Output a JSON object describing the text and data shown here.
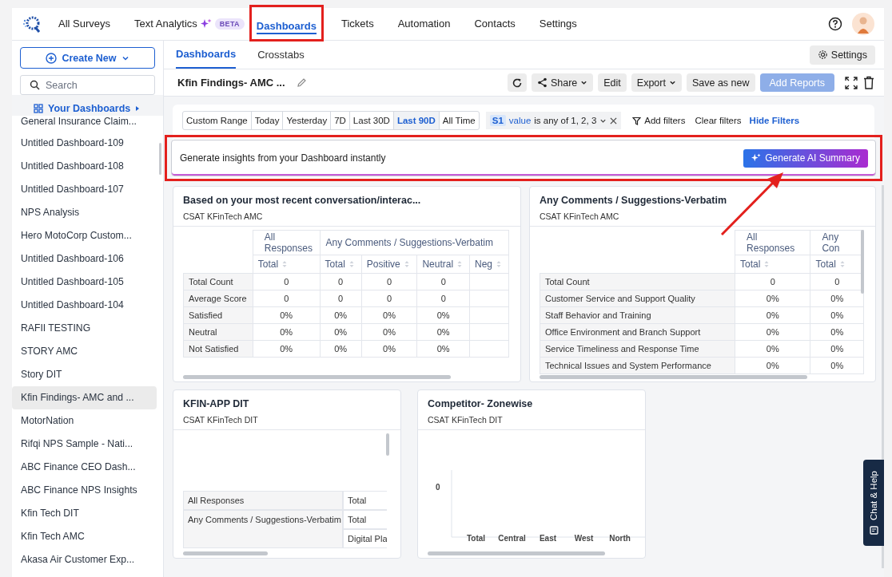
{
  "nav": {
    "items": [
      {
        "label": "All Surveys",
        "selected": false,
        "highlighted": false
      },
      {
        "label": "Text Analytics",
        "selected": false,
        "highlighted": false,
        "badge": "BETA",
        "sparkle": true
      },
      {
        "label": "Dashboards",
        "selected": true,
        "highlighted": true
      },
      {
        "label": "Tickets",
        "selected": false,
        "highlighted": false
      },
      {
        "label": "Automation",
        "selected": false,
        "highlighted": false
      },
      {
        "label": "Contacts",
        "selected": false,
        "highlighted": false
      },
      {
        "label": "Settings",
        "selected": false,
        "highlighted": false
      }
    ]
  },
  "sidebar": {
    "create_button": "Create New",
    "search": {
      "placeholder": "Search"
    },
    "section": "Your Dashboards",
    "items": [
      {
        "label": "General Insurance Claim...",
        "selected": false
      },
      {
        "label": "Untitled Dashboard-109",
        "selected": false
      },
      {
        "label": "Untitled Dashboard-108",
        "selected": false
      },
      {
        "label": "Untitled Dashboard-107",
        "selected": false
      },
      {
        "label": "NPS Analysis",
        "selected": false
      },
      {
        "label": "Hero MotoCorp Custom...",
        "selected": false
      },
      {
        "label": "Untitled Dashboard-106",
        "selected": false
      },
      {
        "label": "Untitled Dashboard-105",
        "selected": false
      },
      {
        "label": "Untitled Dashboard-104",
        "selected": false
      },
      {
        "label": "RAFII TESTING",
        "selected": false
      },
      {
        "label": "STORY AMC",
        "selected": false
      },
      {
        "label": "Story DIT",
        "selected": false
      },
      {
        "label": "Kfin Findings- AMC and ...",
        "selected": true
      },
      {
        "label": "MotorNation",
        "selected": false
      },
      {
        "label": "Rifqi NPS Sample - Nati...",
        "selected": false
      },
      {
        "label": "ABC Finance CEO Dash...",
        "selected": false
      },
      {
        "label": "ABC Finance NPS Insights",
        "selected": false
      },
      {
        "label": "Kfin Tech DIT",
        "selected": false
      },
      {
        "label": "Kfin Tech AMC",
        "selected": false
      },
      {
        "label": "Akasa Air Customer Exp...",
        "selected": false
      }
    ]
  },
  "subtabs": [
    {
      "label": "Dashboards",
      "selected": true
    },
    {
      "label": "Crosstabs",
      "selected": false
    }
  ],
  "settings_button": "Settings",
  "dashboard_title": "Kfin Findings- AMC ...",
  "toolbar": {
    "share": "Share",
    "edit": "Edit",
    "export": "Export",
    "save_as_new": "Save as new",
    "add_reports": {
      "label": "Add Reports",
      "disabled": true
    }
  },
  "date_ranges": [
    {
      "label": "Custom Range",
      "selected": false
    },
    {
      "label": "Today",
      "selected": false
    },
    {
      "label": "Yesterday",
      "selected": false
    },
    {
      "label": "7D",
      "selected": false
    },
    {
      "label": "Last 30D",
      "selected": false
    },
    {
      "label": "Last 90D",
      "selected": true
    },
    {
      "label": "All Time",
      "selected": false
    }
  ],
  "filter_chip": {
    "tag": "S1",
    "field": "value",
    "condition": "is any of 1, 2, 3"
  },
  "filter_actions": {
    "add": "Add filters",
    "clear": "Clear filters",
    "hide": "Hide Filters"
  },
  "banner": {
    "text": "Generate insights from your Dashboard instantly",
    "button": "Generate AI Summary",
    "highlighted": true
  },
  "panels": [
    {
      "kind": "table",
      "title": "Based on your most recent conversation/interac...",
      "subtitle": "CSAT KFinTech AMC",
      "groups": [
        {
          "label": "All Responses"
        },
        {
          "label": "Any Comments / Suggestions-Verbatim"
        }
      ],
      "columns": [
        "Total",
        "Total",
        "Positive",
        "Neutral",
        "Neg"
      ],
      "rows": [
        {
          "label": "Total Count",
          "cells": [
            "0",
            "0",
            "0",
            "0"
          ]
        },
        {
          "label": "Average Score",
          "cells": [
            "0",
            "0",
            "0",
            "0"
          ]
        },
        {
          "label": "Satisfied",
          "cells": [
            "0%",
            "0%",
            "0%",
            "0%"
          ]
        },
        {
          "label": "Neutral",
          "cells": [
            "0%",
            "0%",
            "0%",
            "0%"
          ]
        },
        {
          "label": "Not Satisfied",
          "cells": [
            "0%",
            "0%",
            "0%",
            "0%"
          ]
        }
      ]
    },
    {
      "kind": "table",
      "title": "Any Comments / Suggestions-Verbatim",
      "subtitle": "CSAT KFinTech AMC",
      "groups": [
        {
          "label": "All Responses"
        },
        {
          "label": "Any Con"
        }
      ],
      "columns": [
        "Total",
        "Total"
      ],
      "rows": [
        {
          "label": "Total Count",
          "cells": [
            "0",
            "0"
          ]
        },
        {
          "label": "Customer Service and Support Quality",
          "cells": [
            "0%",
            "0%"
          ]
        },
        {
          "label": "Staff Behavior and Training",
          "cells": [
            "0%",
            "0%"
          ]
        },
        {
          "label": "Office Environment and Branch Support",
          "cells": [
            "0%",
            "0%"
          ]
        },
        {
          "label": "Service Timeliness and Response Time",
          "cells": [
            "0%",
            "0%"
          ]
        },
        {
          "label": "Technical Issues and System Performance",
          "cells": [
            "0%",
            "0%"
          ]
        }
      ]
    },
    {
      "kind": "tree",
      "title": "KFIN-APP DIT",
      "subtitle": "CSAT KFinTech DIT",
      "rows": [
        {
          "label": "All Responses",
          "values": [
            "Total"
          ]
        },
        {
          "label": "Any Comments / Suggestions-Verbatim",
          "values": [
            "Total",
            "Digital Pla"
          ]
        }
      ]
    },
    {
      "kind": "chart",
      "title": "Competitor- Zonewise",
      "subtitle": "CSAT KFinTech DIT",
      "y_tick": "0",
      "categories": [
        "Total",
        "Central",
        "East",
        "West",
        "North"
      ]
    }
  ],
  "chat_help": "Chat & Help"
}
